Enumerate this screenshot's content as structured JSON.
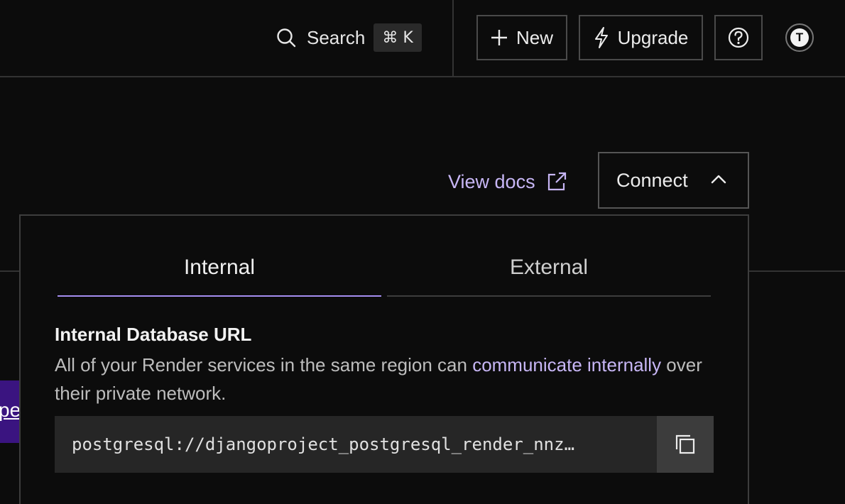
{
  "header": {
    "search_label": "Search",
    "search_shortcut": "⌘ K",
    "new_label": "New",
    "upgrade_label": "Upgrade",
    "avatar_initial": "T"
  },
  "page": {
    "view_docs_label": "View docs",
    "connect_label": "Connect",
    "background_fragment": "pe"
  },
  "connect_panel": {
    "tabs": [
      {
        "label": "Internal",
        "active": true
      },
      {
        "label": "External",
        "active": false
      }
    ],
    "section_title": "Internal Database URL",
    "description_before_link": "All of your Render services in the same region can ",
    "description_link": "communicate internally",
    "description_after_link": " over their private network.",
    "url_value": "postgresql://djangoproject_postgresql_render_nnz…"
  },
  "colors": {
    "accent": "#c7b6f5",
    "tab_indicator": "#a58df0",
    "background": "#0c0c0c"
  },
  "icons": [
    "search-icon",
    "plus-icon",
    "lightning-icon",
    "help-icon",
    "external-link-icon",
    "chevron-up-icon",
    "copy-icon"
  ]
}
